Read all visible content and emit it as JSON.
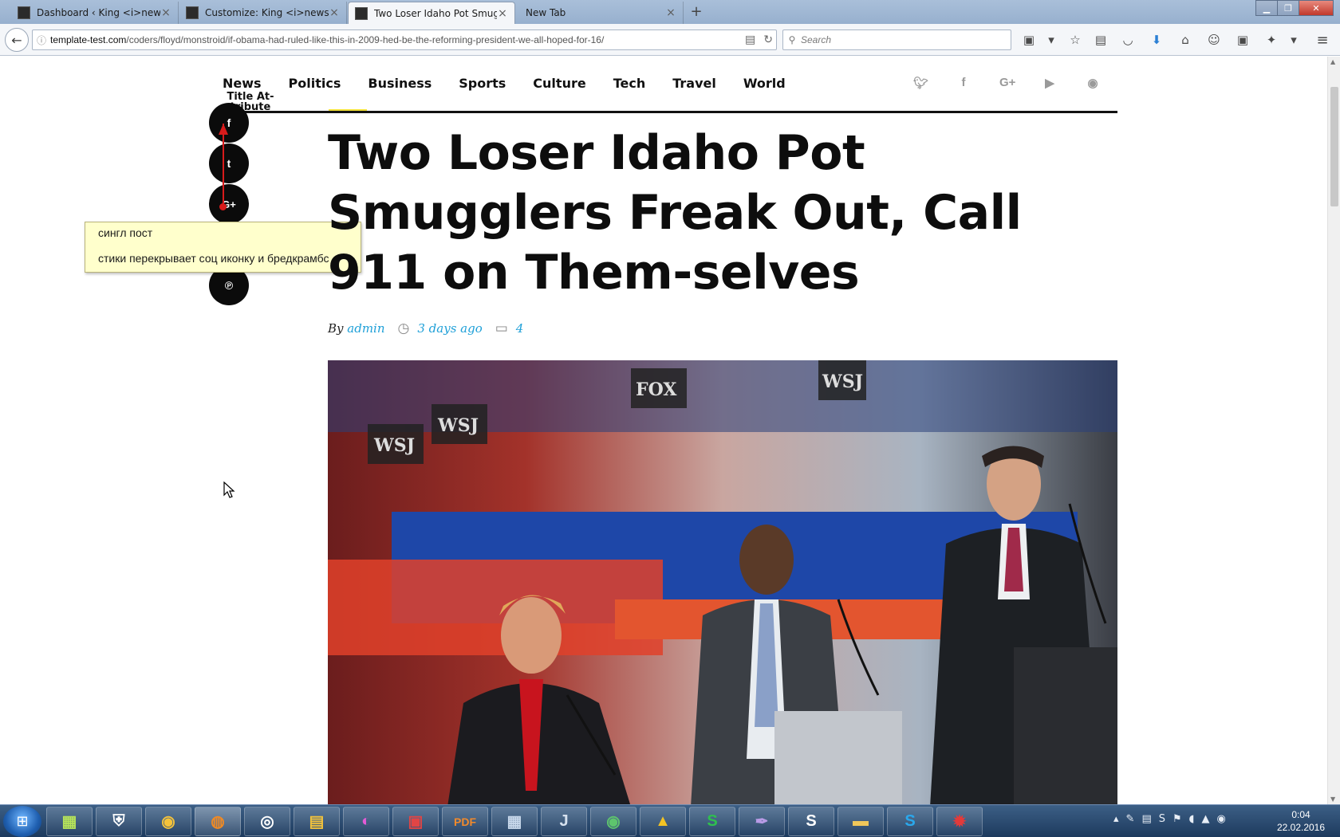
{
  "browser": {
    "tabs": [
      {
        "title": "Dashboard ‹ King <i>news ...",
        "active": false
      },
      {
        "title": "Customize: King <i>news ...",
        "active": false
      },
      {
        "title": "Two Loser Idaho Pot Smug...",
        "active": true
      },
      {
        "title": "New Tab",
        "active": false
      }
    ],
    "url_host": "template-test.com",
    "url_path": "/coders/floyd/monstroid/if-obama-had-ruled-like-this-in-2009-hed-be-the-reforming-president-we-all-hoped-for-16/",
    "search_placeholder": "Search"
  },
  "site": {
    "nav": [
      "News",
      "Politics",
      "Business",
      "Sports",
      "Culture",
      "Tech",
      "Travel",
      "World"
    ],
    "social_top_icons": [
      "twitter-icon",
      "facebook-icon",
      "google-plus-icon",
      "youtube-icon",
      "rss-icon"
    ],
    "title_attr": "Title At-tribute"
  },
  "share_icons": [
    "facebook-icon",
    "twitter-icon",
    "google-plus-icon",
    "pinterest-icon"
  ],
  "note": {
    "line1": "сингл пост",
    "line2": "стики перекрывает соц иконку и бредкрамбс"
  },
  "article": {
    "headline": "Two Loser Idaho Pot Smugglers Freak Out, Call 911 on Them-selves",
    "by_label": "By",
    "author": "admin",
    "time": "3 days ago",
    "comments": "4"
  },
  "taskbar": {
    "time": "0:04",
    "date": "22.02.2016"
  },
  "colors": {
    "accent_link": "#1fa0d8",
    "annotation_red": "#d81b1b",
    "note_bg": "#ffffcc"
  }
}
